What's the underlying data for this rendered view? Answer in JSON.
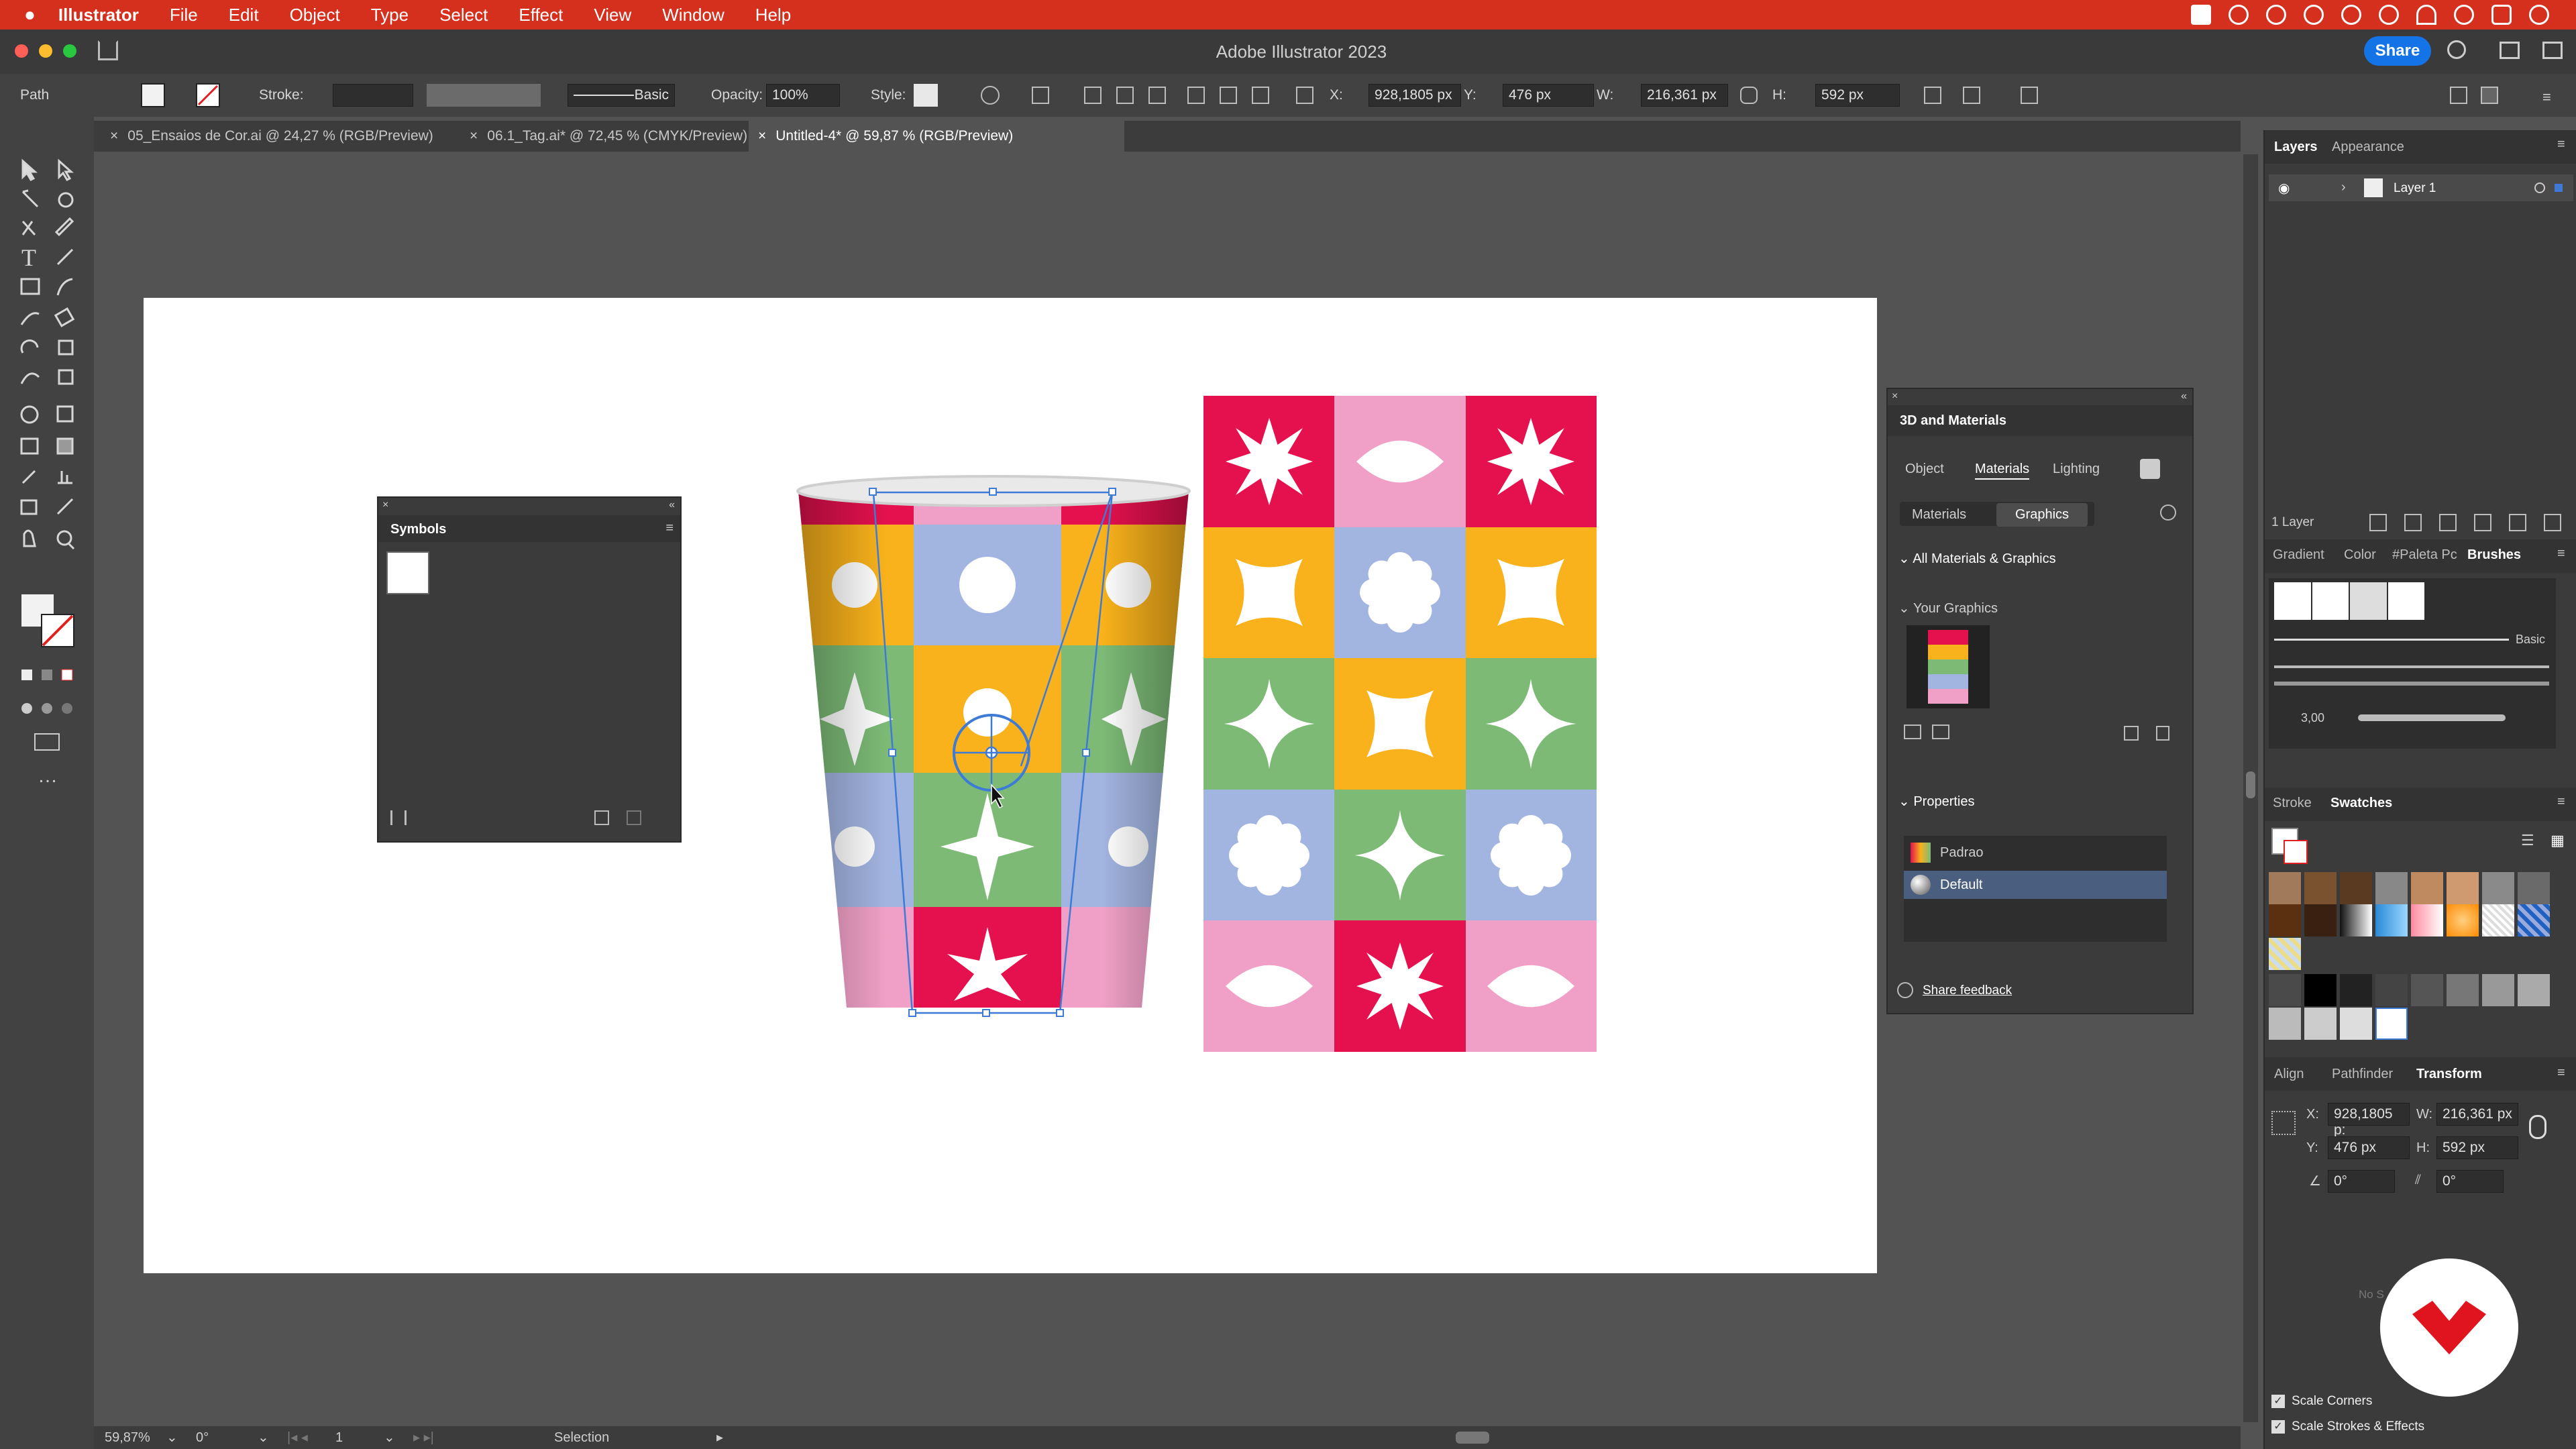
{
  "menubar": {
    "app": "Illustrator",
    "items": [
      "File",
      "Edit",
      "Object",
      "Type",
      "Select",
      "Effect",
      "View",
      "Window",
      "Help"
    ]
  },
  "window": {
    "title": "Adobe Illustrator 2023",
    "share": "Share"
  },
  "control": {
    "path": "Path",
    "stroke": "Stroke:",
    "brush": "Basic",
    "opacity_label": "Opacity:",
    "opacity": "100%",
    "style_label": "Style:",
    "x_label": "X:",
    "x": "928,1805 px",
    "y_label": "Y:",
    "y": "476 px",
    "w_label": "W:",
    "w": "216,361 px",
    "h_label": "H:",
    "h": "592 px"
  },
  "tabs": [
    "05_Ensaios de Cor.ai @ 24,27 % (RGB/Preview)",
    "06.1_Tag.ai* @ 72,45 % (CMYK/Preview)",
    "Untitled-4* @ 59,87 % (RGB/Preview)"
  ],
  "symbols": {
    "title": "Symbols"
  },
  "materials": {
    "title": "3D and Materials",
    "tabs": [
      "Object",
      "Materials",
      "Lighting"
    ],
    "subtabs": [
      "Materials",
      "Graphics"
    ],
    "all": "All Materials & Graphics",
    "your": "Your Graphics",
    "properties": "Properties",
    "props": [
      "Padrao",
      "Default"
    ],
    "feedback": "Share feedback"
  },
  "layers": {
    "tabs": [
      "Layers",
      "Appearance"
    ],
    "layer": "Layer 1",
    "count": "1 Layer"
  },
  "brushes": {
    "tabs": [
      "Gradient",
      "Color",
      "#Paleta Pc",
      "Brushes"
    ],
    "basic": "Basic",
    "size": "3,00"
  },
  "swatches": {
    "tabs": [
      "Stroke",
      "Swatches"
    ]
  },
  "transform": {
    "tabs": [
      "Align",
      "Pathfinder",
      "Transform"
    ],
    "x": "928,1805 p:",
    "y": "476 px",
    "w": "216,361 px",
    "h": "592 px",
    "x_label": "X:",
    "y_label": "Y:",
    "w_label": "W:",
    "h_label": "H:",
    "angle": "0°",
    "shear": "0°",
    "partial": "No S",
    "scale_corners": "Scale Corners",
    "scale_strokes": "Scale Strokes & Effects"
  },
  "status": {
    "zoom": "59,87%",
    "rotate": "0°",
    "page": "1",
    "tool": "Selection"
  },
  "colors": {
    "red": "#e4114e",
    "pink": "#f0a0c6",
    "orange": "#f9b21b",
    "blue": "#a2b4e0",
    "green": "#7cba76",
    "accent": "#d5301e"
  },
  "pattern": {
    "grid": [
      [
        {
          "c": "red",
          "s": "burst"
        },
        {
          "c": "pink",
          "s": "lens"
        },
        {
          "c": "red",
          "s": "burst"
        }
      ],
      [
        {
          "c": "orange",
          "s": "cross"
        },
        {
          "c": "blue",
          "s": "flower"
        },
        {
          "c": "orange",
          "s": "cross"
        }
      ],
      [
        {
          "c": "green",
          "s": "sparkle"
        },
        {
          "c": "orange",
          "s": "cross"
        },
        {
          "c": "green",
          "s": "sparkle"
        }
      ],
      [
        {
          "c": "blue",
          "s": "flower"
        },
        {
          "c": "green",
          "s": "sparkle"
        },
        {
          "c": "blue",
          "s": "flower"
        }
      ],
      [
        {
          "c": "pink",
          "s": "lens"
        },
        {
          "c": "red",
          "s": "burst"
        },
        {
          "c": "pink",
          "s": "lens"
        }
      ]
    ]
  }
}
